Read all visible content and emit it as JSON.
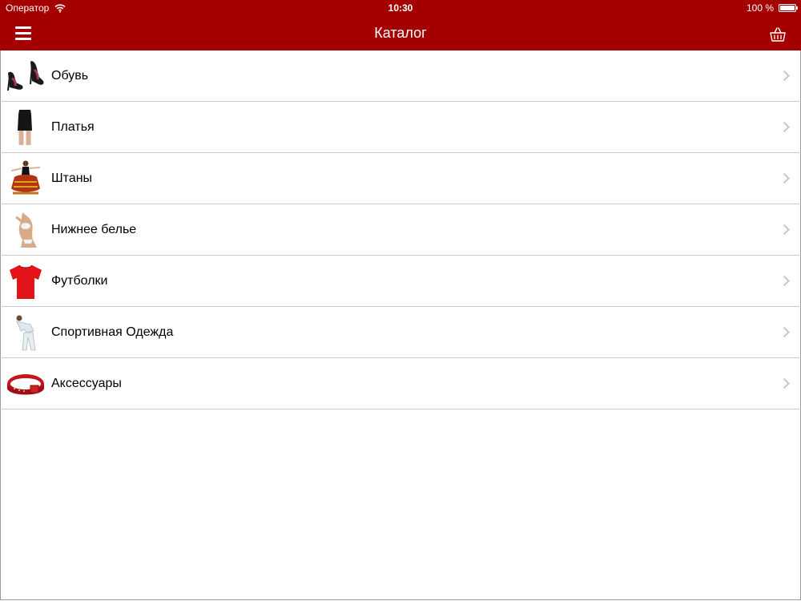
{
  "status_bar": {
    "carrier": "Оператор",
    "time": "10:30",
    "battery": "100 %"
  },
  "nav": {
    "title": "Каталог",
    "left_icon": "hamburger-menu-icon",
    "right_icon": "basket-icon"
  },
  "colors": {
    "bar": "#a40000",
    "separator": "#c8c8cc",
    "chevron": "#c7c7cc"
  },
  "catalog": {
    "items": [
      {
        "label": "Обувь",
        "icon": "shoes"
      },
      {
        "label": "Платья",
        "icon": "dress"
      },
      {
        "label": "Штаны",
        "icon": "pants"
      },
      {
        "label": "Нижнее белье",
        "icon": "underwear"
      },
      {
        "label": "Футболки",
        "icon": "tshirt"
      },
      {
        "label": "Спортивная Одежда",
        "icon": "sportswear"
      },
      {
        "label": "Аксессуары",
        "icon": "belt"
      }
    ]
  }
}
